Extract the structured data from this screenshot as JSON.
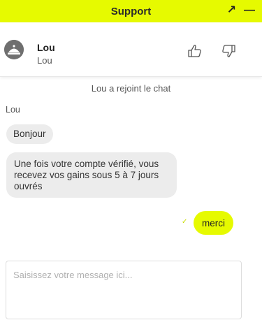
{
  "header": {
    "title": "Support",
    "expand_icon": "↗",
    "minimize_icon": "—",
    "background": "#e6fa00"
  },
  "agent": {
    "name": "Lou",
    "subtitle": "Lou"
  },
  "conversation": {
    "system_message": "Lou a rejoint le chat",
    "sender_label": "Lou",
    "incoming": [
      "Bonjour",
      "Une fois votre compte vérifié, vous recevez vos gains sous 5 à 7 jours ouvrés"
    ],
    "outgoing": [
      {
        "text": "merci",
        "status_icon": "✓"
      }
    ]
  },
  "composer": {
    "placeholder": "Saisissez votre message ici..."
  },
  "colors": {
    "accent": "#e6fa00",
    "incoming_bubble": "#ececec"
  }
}
